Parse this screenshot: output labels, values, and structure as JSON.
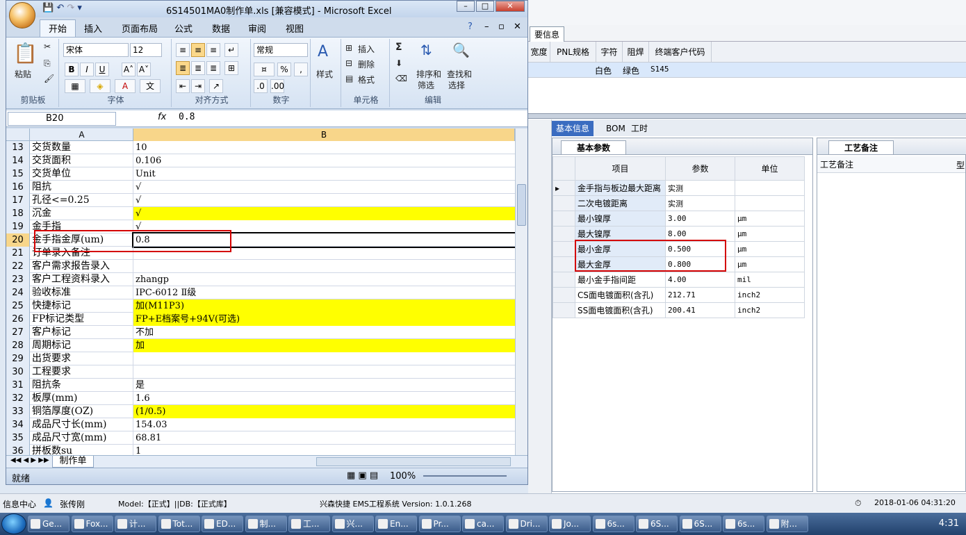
{
  "excel": {
    "title": "6S14501MA0制作单.xls  [兼容模式] - Microsoft Excel",
    "tabs": [
      "开始",
      "插入",
      "页面布局",
      "公式",
      "数据",
      "审阅",
      "视图"
    ],
    "ribbon": {
      "paste": "粘贴",
      "clipboard": "剪贴板",
      "font_name": "宋体",
      "font_size": "12",
      "font": "字体",
      "align": "对齐方式",
      "number_format": "常规",
      "number": "数字",
      "styles": "样式",
      "insert": "插入",
      "delete": "删除",
      "format": "格式",
      "cells": "单元格",
      "sort_filter": "排序和\n筛选",
      "find_select": "查找和\n选择",
      "sort": "排序和",
      "filter": "筛选",
      "find": "查找和",
      "select": "选择",
      "edit": "编辑",
      "bold": "B",
      "italic": "I",
      "underline": "U",
      "sum": "Σ",
      "percent": "%",
      "comma": ","
    },
    "name_box": "B20",
    "fx": "fx",
    "formula_value": "0.8",
    "col_a": "A",
    "col_b": "B",
    "rows": [
      {
        "n": "13",
        "a": "交货数量",
        "b": "10",
        "y": false
      },
      {
        "n": "14",
        "a": "交货面积",
        "b": "0.106",
        "y": false
      },
      {
        "n": "15",
        "a": "交货单位",
        "b": "Unit",
        "y": false
      },
      {
        "n": "16",
        "a": "阻抗",
        "b": "√",
        "y": false
      },
      {
        "n": "17",
        "a": "孔径<=0.25",
        "b": "√",
        "y": false
      },
      {
        "n": "18",
        "a": "沉金",
        "b": "√",
        "y": true
      },
      {
        "n": "19",
        "a": "金手指",
        "b": "√",
        "y": false
      },
      {
        "n": "20",
        "a": "金手指金厚(um)",
        "b": "0.8",
        "y": false
      },
      {
        "n": "21",
        "a": "订单录入备注",
        "b": "",
        "y": false
      },
      {
        "n": "22",
        "a": "客户需求报告录入",
        "b": "",
        "y": false
      },
      {
        "n": "23",
        "a": "客户工程资料录入",
        "b": "zhangp",
        "y": false
      },
      {
        "n": "24",
        "a": "验收标准",
        "b": "IPC-6012 Ⅱ级",
        "y": false
      },
      {
        "n": "25",
        "a": "快捷标记",
        "b": "加(M11P3)",
        "y": true
      },
      {
        "n": "26",
        "a": "FP标记类型",
        "b": "FP+E档案号+94V(可选)",
        "y": true
      },
      {
        "n": "27",
        "a": "客户标记",
        "b": "不加",
        "y": false
      },
      {
        "n": "28",
        "a": "周期标记",
        "b": "加",
        "y": true
      },
      {
        "n": "29",
        "a": "出货要求",
        "b": "",
        "y": false
      },
      {
        "n": "30",
        "a": "工程要求",
        "b": "",
        "y": false
      },
      {
        "n": "31",
        "a": "阻抗条",
        "b": "是",
        "y": false
      },
      {
        "n": "32",
        "a": "板厚(mm)",
        "b": "1.6",
        "y": false
      },
      {
        "n": "33",
        "a": "铜箔厚度(OZ)",
        "b": "(1/0.5)",
        "y": true
      },
      {
        "n": "34",
        "a": "成品尺寸长(mm)",
        "b": "154.03",
        "y": false
      },
      {
        "n": "35",
        "a": "成品尺寸宽(mm)",
        "b": "68.81",
        "y": false
      },
      {
        "n": "36",
        "a": "拼板数su",
        "b": "1",
        "y": false
      }
    ],
    "sheet_tab": "制作单",
    "status_ready": "就绪",
    "zoom": "100%"
  },
  "ems": {
    "tab_top": "要信息",
    "columns": [
      "宽度",
      "PNL规格",
      "字符",
      "阻焊",
      "终端客户代码"
    ],
    "sel_row": [
      "白色",
      "绿色",
      "S145"
    ],
    "tabs": [
      "基本信息",
      "BOM",
      "工时"
    ],
    "group_title": "基本参数",
    "notes_title": "工艺备注",
    "notes_col": "工艺备注",
    "notes_col2": "型",
    "table_headers": [
      "项目",
      "参数",
      "单位"
    ],
    "params": [
      {
        "item": "金手指与板边最大距离",
        "value": "实测",
        "unit": ""
      },
      {
        "item": "二次电镀距离",
        "value": "实测",
        "unit": ""
      },
      {
        "item": "最小镍厚",
        "value": "3.00",
        "unit": "μm"
      },
      {
        "item": "最大镍厚",
        "value": "8.00",
        "unit": "μm"
      },
      {
        "item": "最小金厚",
        "value": "0.500",
        "unit": "μm"
      },
      {
        "item": "最大金厚",
        "value": "0.800",
        "unit": "μm"
      },
      {
        "item": "最小金手指间距",
        "value": "4.00",
        "unit": "mil"
      },
      {
        "item": "CS面电镀面积(含孔)",
        "value": "212.71",
        "unit": "inch2"
      },
      {
        "item": "SS面电镀面积(含孔)",
        "value": "200.41",
        "unit": "inch2"
      }
    ],
    "status": {
      "info_center": "信息中心",
      "user": "张传刚",
      "model": "Model:【正式】||DB:【正式库】",
      "system": "兴森快捷 EMS工程系统 Version: 1.0.1.268",
      "datetime": "2018-01-06 04:31:20"
    }
  },
  "taskbar": {
    "items": [
      "Ge...",
      "Fox...",
      "计...",
      "Tot...",
      "ED...",
      "制...",
      "工...",
      "兴...",
      "En...",
      "Pr...",
      "ca...",
      "Dri...",
      "Jo...",
      "6s...",
      "6S...",
      "6S...",
      "6s...",
      "附..."
    ],
    "clock": "4:31"
  }
}
